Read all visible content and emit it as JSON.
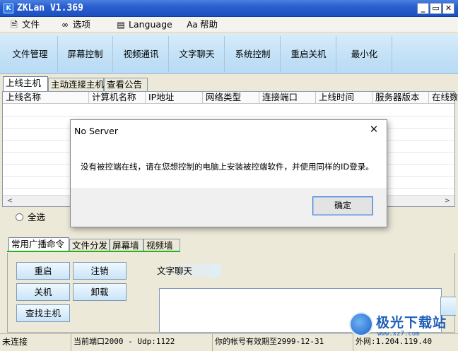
{
  "window": {
    "app_icon": "K",
    "title": "ZKLan V1.369",
    "controls": {
      "minimize": "_",
      "restore": "▭",
      "close": "✕"
    }
  },
  "menu": [
    {
      "label": "文件",
      "icon": "file-icon",
      "glyph": "🗎"
    },
    {
      "label": "选项",
      "icon": "glasses-icon",
      "glyph": "∞"
    },
    {
      "label": "Language",
      "icon": "language-icon",
      "glyph": "▤"
    },
    {
      "label": "帮助",
      "icon": "help-icon",
      "glyph": "Aa"
    }
  ],
  "toolbar": [
    "文件管理",
    "屏幕控制",
    "视频通讯",
    "文字聊天",
    "系统控制",
    "重启关机",
    "最小化"
  ],
  "top_tabs": [
    "上线主机",
    "主动连接主机",
    "查看公告"
  ],
  "grid": {
    "columns": [
      "上线名称",
      "计算机名称",
      "IP地址",
      "网络类型",
      "连接端口",
      "上线时间",
      "服务器版本",
      "在线数"
    ],
    "scroll_left": "<",
    "scroll_right": ">"
  },
  "select_all": "全选",
  "cmd_tabs": [
    "常用广播命令",
    "文件分发",
    "屏幕墙",
    "视频墙"
  ],
  "cmd_buttons": {
    "restart": "重启",
    "logoff": "注销",
    "shutdown": "关机",
    "uninstall": "卸载",
    "find_host": "查找主机"
  },
  "chat": {
    "label": "文字聊天"
  },
  "status": {
    "connection": "未连接",
    "port": "当前端口2000 - Udp:1122",
    "expiry": "你的帐号有效期至2999-12-31",
    "wan": "外网:1.204.119.40"
  },
  "dialog": {
    "title": "No Server",
    "close": "✕",
    "message": "没有被控端在线，请在您想控制的电脑上安装被控端软件，并使用同样的ID登录。",
    "ok": "确定"
  },
  "watermark": {
    "text": "极光下载站",
    "sub": "www.xz7.com"
  }
}
